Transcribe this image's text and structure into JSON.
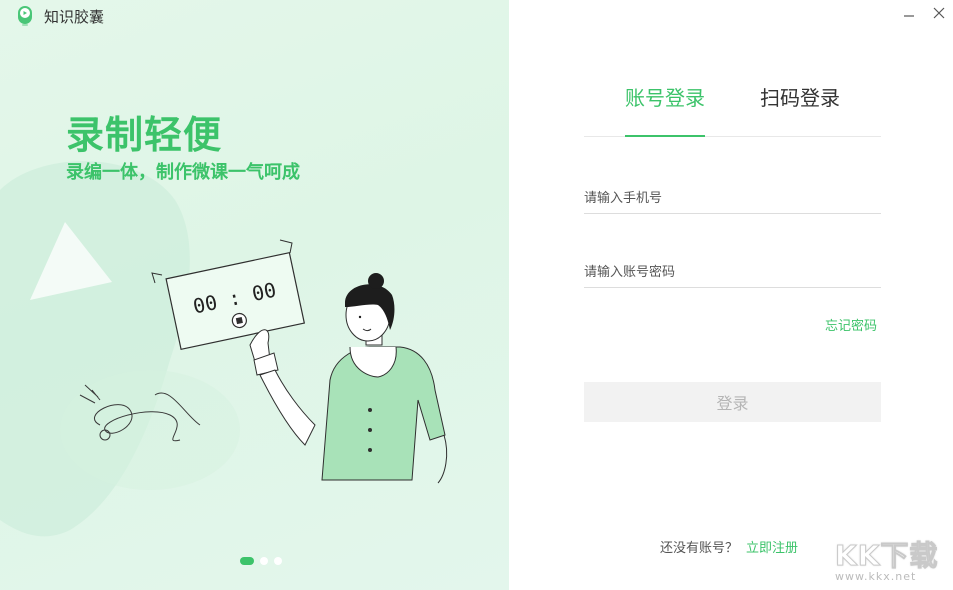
{
  "app": {
    "title": "知识胶囊",
    "logo_icon": "capsule-logo-icon"
  },
  "window_controls": {
    "minimize": "–",
    "close": "✕"
  },
  "promo": {
    "title": "录制轻便",
    "subtitle": "录编一体，制作微课一气呵成",
    "timer": "00 : 00",
    "carousel": {
      "count": 3,
      "active": 0
    }
  },
  "login": {
    "tabs": [
      {
        "label": "账号登录",
        "active": true
      },
      {
        "label": "扫码登录",
        "active": false
      }
    ],
    "phone_placeholder": "请输入手机号",
    "password_placeholder": "请输入账号密码",
    "forgot_label": "忘记密码",
    "submit_label": "登录",
    "no_account_text": "还没有账号？",
    "register_label": "立即注册"
  },
  "watermark": {
    "logo": "KK下载",
    "url": "www.kkx.net"
  },
  "colors": {
    "accent": "#3cc36a",
    "panel_bg": "#e1f6e8",
    "shirt": "#a8e2b8"
  }
}
